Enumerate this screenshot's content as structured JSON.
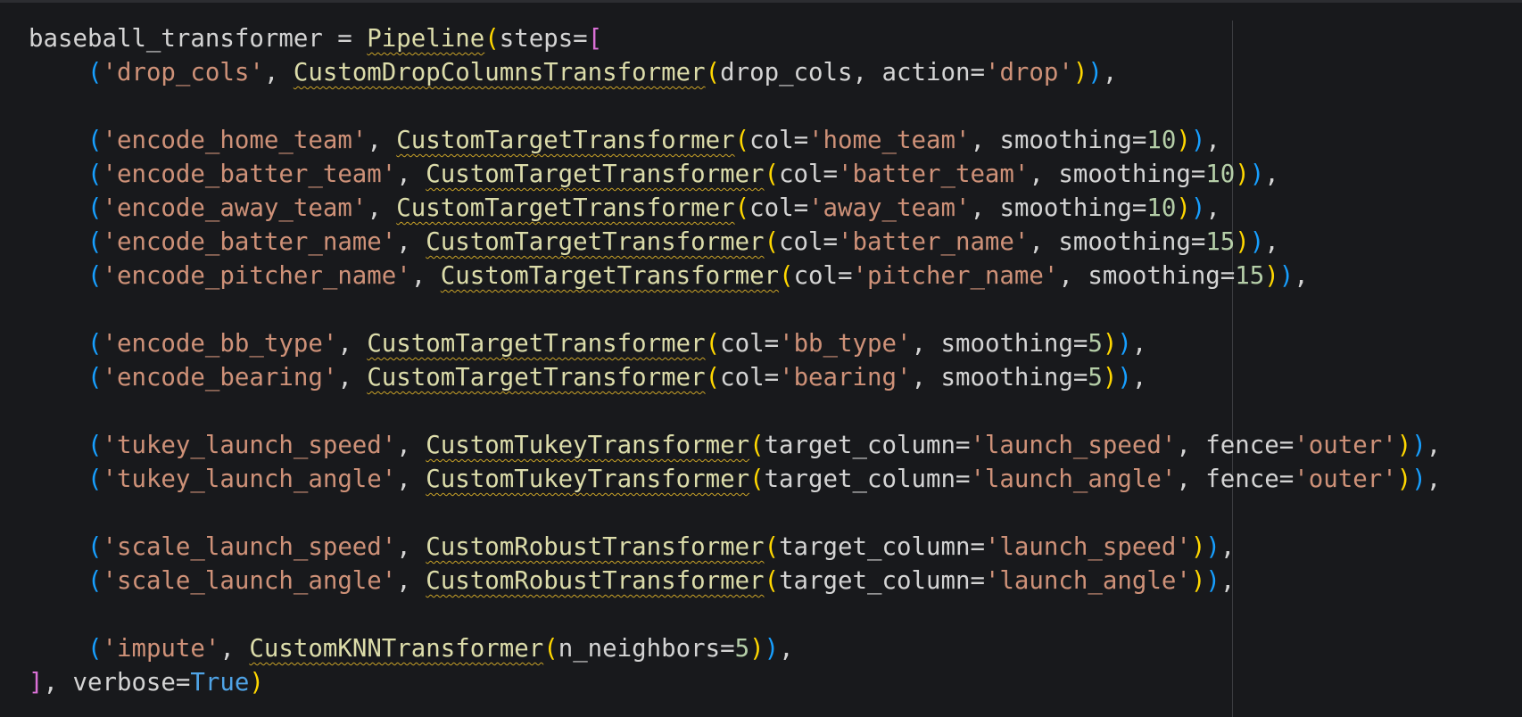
{
  "editor": {
    "language": "python",
    "colors": {
      "background": "#18191c",
      "text": "#d4d4d4",
      "string": "#ce9178",
      "number": "#b5cea8",
      "keyword": "#4fa3e6",
      "bracket_gold": "#ffd700",
      "bracket_purple": "#da70d6",
      "bracket_blue": "#179fff",
      "warning_squiggle": "#c9a227"
    },
    "lines": [
      [
        {
          "t": "baseball_transformer = ",
          "c": "txt"
        },
        {
          "t": "Pipeline",
          "c": "cls",
          "w": true
        },
        {
          "t": "(",
          "c": "b1"
        },
        {
          "t": "steps=",
          "c": "txt"
        },
        {
          "t": "[",
          "c": "b2"
        }
      ],
      [
        {
          "t": "    ",
          "c": "txt"
        },
        {
          "t": "(",
          "c": "b3"
        },
        {
          "t": "'drop_cols'",
          "c": "str"
        },
        {
          "t": ", ",
          "c": "txt"
        },
        {
          "t": "CustomDropColumnsTransformer",
          "c": "cls",
          "w": true
        },
        {
          "t": "(",
          "c": "b1"
        },
        {
          "t": "drop_cols, action=",
          "c": "txt"
        },
        {
          "t": "'drop'",
          "c": "str"
        },
        {
          "t": ")",
          "c": "b1"
        },
        {
          "t": ")",
          "c": "b3"
        },
        {
          "t": ",",
          "c": "txt"
        }
      ],
      [],
      [
        {
          "t": "    ",
          "c": "txt"
        },
        {
          "t": "(",
          "c": "b3"
        },
        {
          "t": "'encode_home_team'",
          "c": "str"
        },
        {
          "t": ", ",
          "c": "txt"
        },
        {
          "t": "CustomTargetTransformer",
          "c": "cls",
          "w": true
        },
        {
          "t": "(",
          "c": "b1"
        },
        {
          "t": "col=",
          "c": "txt"
        },
        {
          "t": "'home_team'",
          "c": "str"
        },
        {
          "t": ", smoothing=",
          "c": "txt"
        },
        {
          "t": "10",
          "c": "num"
        },
        {
          "t": ")",
          "c": "b1"
        },
        {
          "t": ")",
          "c": "b3"
        },
        {
          "t": ",",
          "c": "txt"
        }
      ],
      [
        {
          "t": "    ",
          "c": "txt"
        },
        {
          "t": "(",
          "c": "b3"
        },
        {
          "t": "'encode_batter_team'",
          "c": "str"
        },
        {
          "t": ", ",
          "c": "txt"
        },
        {
          "t": "CustomTargetTransformer",
          "c": "cls",
          "w": true
        },
        {
          "t": "(",
          "c": "b1"
        },
        {
          "t": "col=",
          "c": "txt"
        },
        {
          "t": "'batter_team'",
          "c": "str"
        },
        {
          "t": ", smoothing=",
          "c": "txt"
        },
        {
          "t": "10",
          "c": "num"
        },
        {
          "t": ")",
          "c": "b1"
        },
        {
          "t": ")",
          "c": "b3"
        },
        {
          "t": ",",
          "c": "txt"
        }
      ],
      [
        {
          "t": "    ",
          "c": "txt"
        },
        {
          "t": "(",
          "c": "b3"
        },
        {
          "t": "'encode_away_team'",
          "c": "str"
        },
        {
          "t": ", ",
          "c": "txt"
        },
        {
          "t": "CustomTargetTransformer",
          "c": "cls",
          "w": true
        },
        {
          "t": "(",
          "c": "b1"
        },
        {
          "t": "col=",
          "c": "txt"
        },
        {
          "t": "'away_team'",
          "c": "str"
        },
        {
          "t": ", smoothing=",
          "c": "txt"
        },
        {
          "t": "10",
          "c": "num"
        },
        {
          "t": ")",
          "c": "b1"
        },
        {
          "t": ")",
          "c": "b3"
        },
        {
          "t": ",",
          "c": "txt"
        }
      ],
      [
        {
          "t": "    ",
          "c": "txt"
        },
        {
          "t": "(",
          "c": "b3"
        },
        {
          "t": "'encode_batter_name'",
          "c": "str"
        },
        {
          "t": ", ",
          "c": "txt"
        },
        {
          "t": "CustomTargetTransformer",
          "c": "cls",
          "w": true
        },
        {
          "t": "(",
          "c": "b1"
        },
        {
          "t": "col=",
          "c": "txt"
        },
        {
          "t": "'batter_name'",
          "c": "str"
        },
        {
          "t": ", smoothing=",
          "c": "txt"
        },
        {
          "t": "15",
          "c": "num"
        },
        {
          "t": ")",
          "c": "b1"
        },
        {
          "t": ")",
          "c": "b3"
        },
        {
          "t": ",",
          "c": "txt"
        }
      ],
      [
        {
          "t": "    ",
          "c": "txt"
        },
        {
          "t": "(",
          "c": "b3"
        },
        {
          "t": "'encode_pitcher_name'",
          "c": "str"
        },
        {
          "t": ", ",
          "c": "txt"
        },
        {
          "t": "CustomTargetTransformer",
          "c": "cls",
          "w": true
        },
        {
          "t": "(",
          "c": "b1"
        },
        {
          "t": "col=",
          "c": "txt"
        },
        {
          "t": "'pitcher_name'",
          "c": "str"
        },
        {
          "t": ", smoothing=",
          "c": "txt"
        },
        {
          "t": "15",
          "c": "num"
        },
        {
          "t": ")",
          "c": "b1"
        },
        {
          "t": ")",
          "c": "b3"
        },
        {
          "t": ",",
          "c": "txt"
        }
      ],
      [],
      [
        {
          "t": "    ",
          "c": "txt"
        },
        {
          "t": "(",
          "c": "b3"
        },
        {
          "t": "'encode_bb_type'",
          "c": "str"
        },
        {
          "t": ", ",
          "c": "txt"
        },
        {
          "t": "CustomTargetTransformer",
          "c": "cls",
          "w": true
        },
        {
          "t": "(",
          "c": "b1"
        },
        {
          "t": "col=",
          "c": "txt"
        },
        {
          "t": "'bb_type'",
          "c": "str"
        },
        {
          "t": ", smoothing=",
          "c": "txt"
        },
        {
          "t": "5",
          "c": "num"
        },
        {
          "t": ")",
          "c": "b1"
        },
        {
          "t": ")",
          "c": "b3"
        },
        {
          "t": ",",
          "c": "txt"
        }
      ],
      [
        {
          "t": "    ",
          "c": "txt"
        },
        {
          "t": "(",
          "c": "b3"
        },
        {
          "t": "'encode_bearing'",
          "c": "str"
        },
        {
          "t": ", ",
          "c": "txt"
        },
        {
          "t": "CustomTargetTransformer",
          "c": "cls",
          "w": true
        },
        {
          "t": "(",
          "c": "b1"
        },
        {
          "t": "col=",
          "c": "txt"
        },
        {
          "t": "'bearing'",
          "c": "str"
        },
        {
          "t": ", smoothing=",
          "c": "txt"
        },
        {
          "t": "5",
          "c": "num"
        },
        {
          "t": ")",
          "c": "b1"
        },
        {
          "t": ")",
          "c": "b3"
        },
        {
          "t": ",",
          "c": "txt"
        }
      ],
      [],
      [
        {
          "t": "    ",
          "c": "txt"
        },
        {
          "t": "(",
          "c": "b3"
        },
        {
          "t": "'tukey_launch_speed'",
          "c": "str"
        },
        {
          "t": ", ",
          "c": "txt"
        },
        {
          "t": "CustomTukeyTransformer",
          "c": "cls",
          "w": true
        },
        {
          "t": "(",
          "c": "b1"
        },
        {
          "t": "target_column=",
          "c": "txt"
        },
        {
          "t": "'launch_speed'",
          "c": "str"
        },
        {
          "t": ", fence=",
          "c": "txt"
        },
        {
          "t": "'outer'",
          "c": "str"
        },
        {
          "t": ")",
          "c": "b1"
        },
        {
          "t": ")",
          "c": "b3"
        },
        {
          "t": ",",
          "c": "txt"
        }
      ],
      [
        {
          "t": "    ",
          "c": "txt"
        },
        {
          "t": "(",
          "c": "b3"
        },
        {
          "t": "'tukey_launch_angle'",
          "c": "str"
        },
        {
          "t": ", ",
          "c": "txt"
        },
        {
          "t": "CustomTukeyTransformer",
          "c": "cls",
          "w": true
        },
        {
          "t": "(",
          "c": "b1"
        },
        {
          "t": "target_column=",
          "c": "txt"
        },
        {
          "t": "'launch_angle'",
          "c": "str"
        },
        {
          "t": ", fence=",
          "c": "txt"
        },
        {
          "t": "'outer'",
          "c": "str"
        },
        {
          "t": ")",
          "c": "b1"
        },
        {
          "t": ")",
          "c": "b3"
        },
        {
          "t": ",",
          "c": "txt"
        }
      ],
      [],
      [
        {
          "t": "    ",
          "c": "txt"
        },
        {
          "t": "(",
          "c": "b3"
        },
        {
          "t": "'scale_launch_speed'",
          "c": "str"
        },
        {
          "t": ", ",
          "c": "txt"
        },
        {
          "t": "CustomRobustTransformer",
          "c": "cls",
          "w": true
        },
        {
          "t": "(",
          "c": "b1"
        },
        {
          "t": "target_column=",
          "c": "txt"
        },
        {
          "t": "'launch_speed'",
          "c": "str"
        },
        {
          "t": ")",
          "c": "b1"
        },
        {
          "t": ")",
          "c": "b3"
        },
        {
          "t": ",",
          "c": "txt"
        }
      ],
      [
        {
          "t": "    ",
          "c": "txt"
        },
        {
          "t": "(",
          "c": "b3"
        },
        {
          "t": "'scale_launch_angle'",
          "c": "str"
        },
        {
          "t": ", ",
          "c": "txt"
        },
        {
          "t": "CustomRobustTransformer",
          "c": "cls",
          "w": true
        },
        {
          "t": "(",
          "c": "b1"
        },
        {
          "t": "target_column=",
          "c": "txt"
        },
        {
          "t": "'launch_angle'",
          "c": "str"
        },
        {
          "t": ")",
          "c": "b1"
        },
        {
          "t": ")",
          "c": "b3"
        },
        {
          "t": ",",
          "c": "txt"
        }
      ],
      [],
      [
        {
          "t": "    ",
          "c": "txt"
        },
        {
          "t": "(",
          "c": "b3"
        },
        {
          "t": "'impute'",
          "c": "str"
        },
        {
          "t": ", ",
          "c": "txt"
        },
        {
          "t": "CustomKNNTransformer",
          "c": "cls",
          "w": true
        },
        {
          "t": "(",
          "c": "b1"
        },
        {
          "t": "n_neighbors=",
          "c": "txt"
        },
        {
          "t": "5",
          "c": "num"
        },
        {
          "t": ")",
          "c": "b1"
        },
        {
          "t": ")",
          "c": "b3"
        },
        {
          "t": ",",
          "c": "txt"
        }
      ],
      [
        {
          "t": "]",
          "c": "b2"
        },
        {
          "t": ", verbose=",
          "c": "txt"
        },
        {
          "t": "True",
          "c": "kw"
        },
        {
          "t": ")",
          "c": "b1"
        }
      ]
    ]
  }
}
